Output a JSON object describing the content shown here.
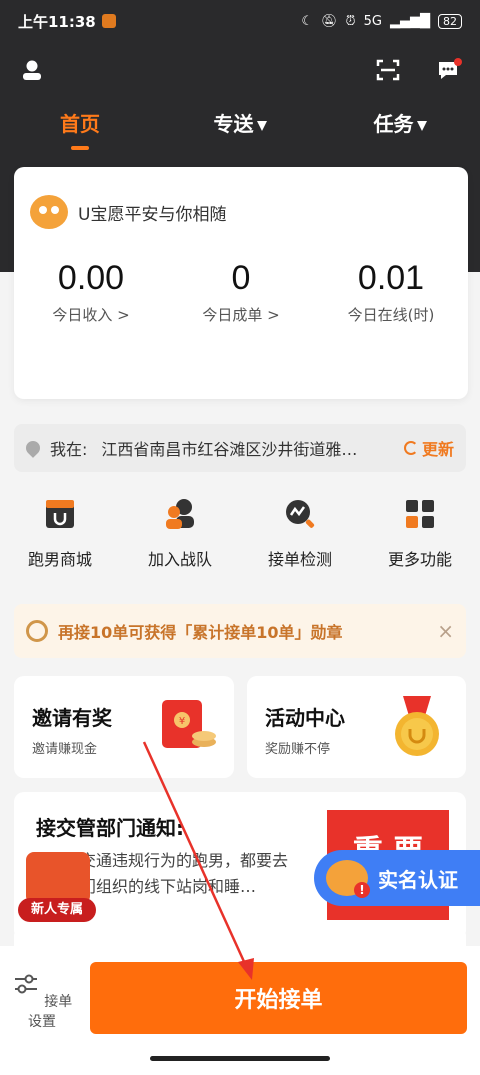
{
  "status_bar": {
    "time": "上午11:38",
    "network": "5G",
    "battery": "82"
  },
  "tabs": [
    {
      "label": "首页",
      "active": true
    },
    {
      "label": "专送",
      "active": false
    },
    {
      "label": "任务",
      "active": false
    }
  ],
  "stats": {
    "greeting": "U宝愿平安与你相随",
    "items": [
      {
        "value": "0.00",
        "label": "今日收入 >"
      },
      {
        "value": "0",
        "label": "今日成单 >"
      },
      {
        "value": "0.01",
        "label": "今日在线(时)"
      }
    ]
  },
  "location": {
    "prefix": "我在:",
    "address": "江西省南昌市红谷滩区沙井街道雅…",
    "refresh_label": "更新"
  },
  "features": [
    {
      "label": "跑男商城",
      "icon": "shop-icon"
    },
    {
      "label": "加入战队",
      "icon": "team-icon"
    },
    {
      "label": "接单检测",
      "icon": "check-icon"
    },
    {
      "label": "更多功能",
      "icon": "grid-icon"
    }
  ],
  "badge_banner": {
    "text": "再接10单可获得「累计接单10单」勋章",
    "close": "×"
  },
  "promos": [
    {
      "title": "邀请有奖",
      "subtitle": "邀请赚现金"
    },
    {
      "title": "活动中心",
      "subtitle": "奖励赚不停"
    }
  ],
  "notice": {
    "title": "接交管部门通知:",
    "body": "凡是有交通违规行为的跑男，都要去交管部门组织的线下站岗和睡…",
    "poster_text": "重 要"
  },
  "newbie_badge": "新人专属",
  "verify_button": "实名认证",
  "bottom": {
    "settings_label": "接单设置",
    "start_label": "开始接单"
  },
  "colors": {
    "accent": "#ff6d0c",
    "header_bg": "#2a2a2c",
    "verify_blue": "#3f7ef5",
    "annotation_red": "#e8322a"
  }
}
